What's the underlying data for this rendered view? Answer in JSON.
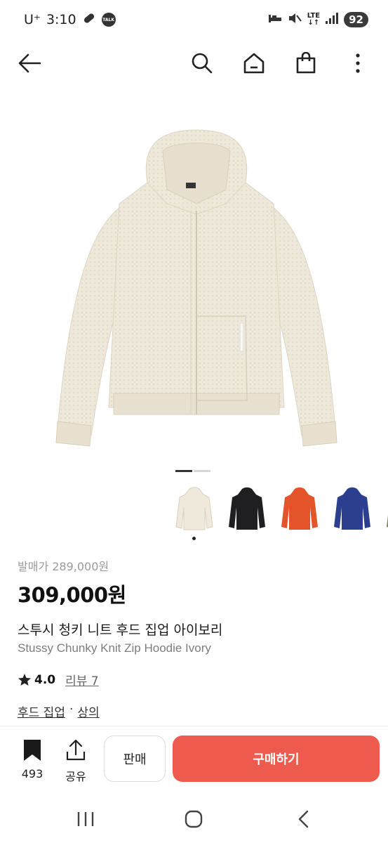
{
  "status_bar": {
    "carrier": "U⁺",
    "time": "3:10",
    "talk_badge": "TALK",
    "network": "LTE",
    "battery": "92"
  },
  "product": {
    "original_price": "발매가 289,000원",
    "price": "309,000원",
    "title_ko": "스투시 청키 니트 후드 집업 아이보리",
    "title_en": "Stussy Chunky Knit Zip Hoodie Ivory",
    "rating": "4.0",
    "review_label": "리뷰 7",
    "category_1": "후드 집업",
    "category_sep": "·",
    "category_2": "상의",
    "hero_color": "#efe9dc",
    "color_options": [
      "ivory",
      "black",
      "orange",
      "navy",
      "olive"
    ]
  },
  "actions": {
    "bookmark_count": "493",
    "share_label": "공유",
    "sell_label": "판매",
    "buy_label": "구매하기",
    "buy_color": "#ef5a4f"
  }
}
